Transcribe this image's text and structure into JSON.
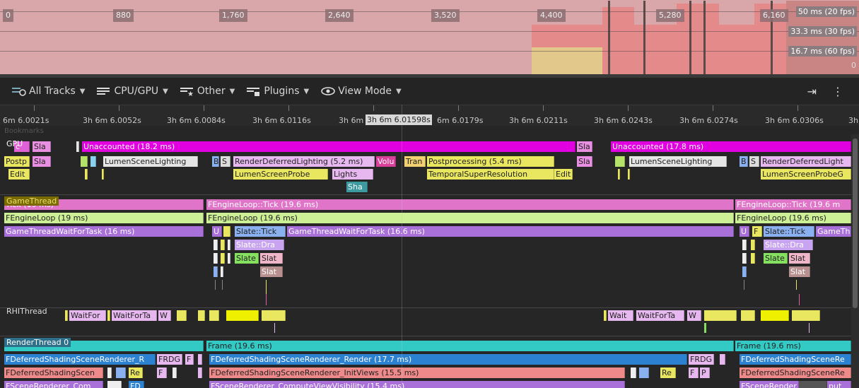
{
  "frames": {
    "ticks": [
      "0",
      "880",
      "1,760",
      "2,640",
      "3,520",
      "4,400",
      "5,280",
      "6,160"
    ],
    "ref_labels": [
      "50 ms (20 fps)",
      "33.3 ms (30 fps)",
      "16.7 ms (60 fps)"
    ],
    "zero_label": "0"
  },
  "toolbar": {
    "all_tracks": "All Tracks",
    "cpu_gpu": "CPU/GPU",
    "other": "Other",
    "plugins": "Plugins",
    "view_mode": "View Mode"
  },
  "ruler": {
    "labels": [
      "6m 6.0021s",
      "3h 6m 6.0052s",
      "3h 6m 6.0084s",
      "3h 6m 6.0116s",
      "3h 6m",
      "6m 6.0179s",
      "3h 6m 6.0211s",
      "3h 6m 6.0243s",
      "3h 6m 6.0274s",
      "3h 6m 6.0306s",
      "3h"
    ],
    "current": "3h 6m 6.01598s",
    "bookmarks": "Bookmarks"
  },
  "tracks": {
    "gpu": "GPU",
    "game_thread": "GameThread",
    "rhi_thread": "RHIThread",
    "render_thread": "RenderThread 0"
  },
  "events": {
    "g0": [
      "c",
      "Sla",
      "Unaccounted (18.2 ms)",
      "Sla",
      "Unaccounted (17.8 ms)"
    ],
    "g1": [
      "Postp",
      "Sla",
      "LumenSceneLighting",
      "B",
      "S",
      "RenderDeferredLighting (5.2 ms)",
      "Volu",
      "Tran",
      "Postprocessing (5.4 ms)",
      "Sla",
      "LumenSceneLighting",
      "B",
      "S",
      "RenderDeferredLight"
    ],
    "g2": [
      "Edit",
      "LumenScreenProbe",
      "Lights",
      "TemporalSuperResolution",
      "Edit",
      "LumenScreenProbeG"
    ],
    "g3": [
      "Sha"
    ],
    "t0": [
      "Tick (19 ms)",
      "FEngineLoop::Tick (19.6 ms)",
      "FEngineLoop::Tick (19.6 m"
    ],
    "t1": [
      "FEngineLoop (19 ms)",
      "FEngineLoop (19.6 ms)",
      "FEngineLoop (19.6 ms)"
    ],
    "t2": [
      "GameThreadWaitForTask (16 ms)",
      "U",
      "Slate::Tick",
      "GameThreadWaitForTask (16.6 ms)",
      "U",
      "F",
      "Slate::Tick",
      "GameTh"
    ],
    "t3": [
      "Slate::Dra",
      "Slate::Dra"
    ],
    "t4": [
      "Slate",
      "Slat",
      "Slate",
      "Slat"
    ],
    "t5": [
      "Slat",
      "Slat"
    ],
    "r0": [
      "WaitFor",
      "WaitForTa",
      "W",
      "Wait",
      "WaitForTa",
      "W"
    ],
    "rt0": [
      "Frame (19.6 ms)",
      "Frame (19.6 ms)"
    ],
    "rt1": [
      "FDeferredShadingSceneRenderer_R",
      "FRDG",
      "F",
      "FDeferredShadingSceneRenderer_Render (17.7 ms)",
      "FRDG",
      "FDeferredShadingSceneRe"
    ],
    "rt2": [
      "FDeferredShadingScen",
      "Re",
      "F",
      "FDeferredShadingSceneRenderer_InitViews (15.5 ms)",
      "Re",
      "F",
      "P",
      "FDeferredShadingSceneRe"
    ],
    "rt3": [
      "FSceneRenderer_Com",
      "FD",
      "FSceneRenderer_ComputeViewVisibility (15.4 ms)",
      "FSceneRender",
      "put"
    ]
  }
}
